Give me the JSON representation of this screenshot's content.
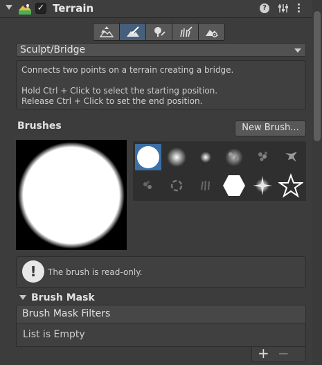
{
  "header": {
    "title": "Terrain",
    "enabled_mark": "✓",
    "help_glyph": "?"
  },
  "toolbar": {
    "tools": [
      {
        "icon": "raise-lower-terrain-icon",
        "active": false
      },
      {
        "icon": "paint-terrain-icon",
        "active": true
      },
      {
        "icon": "paint-trees-icon",
        "active": false
      },
      {
        "icon": "paint-details-icon",
        "active": false
      },
      {
        "icon": "terrain-settings-icon",
        "active": false
      }
    ]
  },
  "tool_dropdown": {
    "selected": "Sculpt/Bridge"
  },
  "description": {
    "line1": "Connects two points on a terrain creating a bridge.",
    "line2": "Hold Ctrl + Click to select the starting position.",
    "line3": "Release Ctrl + Click to set the end position."
  },
  "brushes": {
    "label": "Brushes",
    "new_brush_label": "New Brush...",
    "selected_index": 0,
    "items": [
      {
        "icon": "hard-round-brush-icon"
      },
      {
        "icon": "soft-round-brush-icon"
      },
      {
        "icon": "small-soft-brush-icon"
      },
      {
        "icon": "noise-cloud-brush-icon"
      },
      {
        "icon": "scatter-brush-icon"
      },
      {
        "icon": "splatter-brush-icon"
      },
      {
        "icon": "speckle-brush-icon"
      },
      {
        "icon": "ring-noise-brush-icon"
      },
      {
        "icon": "streak-brush-icon"
      },
      {
        "icon": "hexagon-brush-icon"
      },
      {
        "icon": "sparkle-brush-icon"
      },
      {
        "icon": "star-outline-brush-icon"
      }
    ]
  },
  "readonly_notice": {
    "icon": "info-exclamation-icon",
    "text": "The brush is read-only."
  },
  "brush_mask": {
    "label": "Brush Mask",
    "filters_header": "Brush Mask Filters",
    "empty_text": "List is Empty",
    "add_glyph": "+",
    "remove_glyph": "−"
  },
  "colors": {
    "panel_bg": "#3c3c3c",
    "active_tool": "#46607c",
    "selected_brush": "#3a6fa8"
  }
}
